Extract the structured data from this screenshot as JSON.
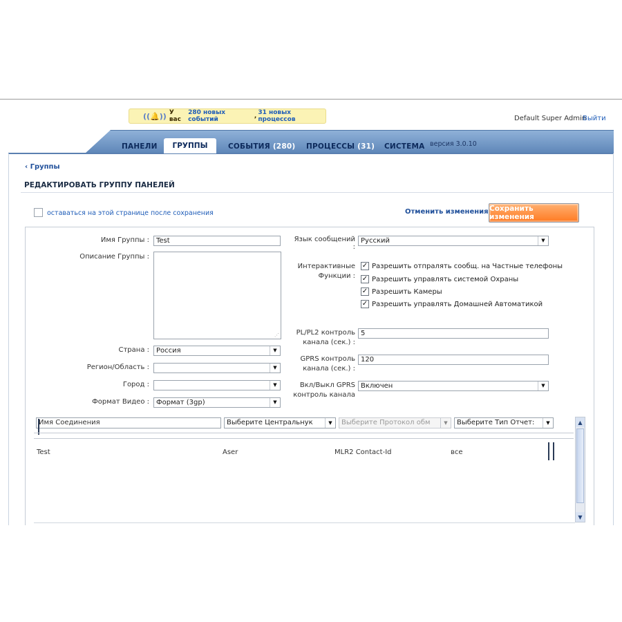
{
  "notification": {
    "prefix": "У вас",
    "events_count": "280 новых событий",
    "separator": ",",
    "processes_count": "31 новых процессов"
  },
  "header": {
    "user": "Default Super Admin",
    "logout": "Выйти",
    "version": "версия 3.0.10"
  },
  "nav": {
    "tabs": [
      {
        "label": "ПАНЕЛИ",
        "count": ""
      },
      {
        "label": "ГРУППЫ",
        "count": ""
      },
      {
        "label": "СОБЫТИЯ",
        "count": "(280)"
      },
      {
        "label": "ПРОЦЕССЫ",
        "count": "(31)"
      },
      {
        "label": "СИСТЕМА",
        "count": ""
      }
    ],
    "active": "ГРУППЫ"
  },
  "breadcrumb": "‹ Группы",
  "page_title": "РЕДАКТИРОВАТЬ ГРУППУ ПАНЕЛЕЙ",
  "stay_label": "оставаться на этой странице после сохранения",
  "actions": {
    "cancel": "Отменить изменения",
    "save": "Сохранить изменения"
  },
  "form": {
    "group_name_label": "Имя Группы :",
    "group_name_value": "Test",
    "description_label": "Описание Группы :",
    "country_label": "Страна :",
    "country_value": "Россия",
    "region_label": "Регион/Область :",
    "region_value": "",
    "city_label": "Город :",
    "city_value": "",
    "video_label": "Формат Видео :",
    "video_value": "Формат (3gp)",
    "lang_label_1": "Язык сообщений",
    "lang_label_2": ":",
    "lang_value": "Русский",
    "interactive_label_1": "Интерактивные",
    "interactive_label_2": "Функции :",
    "checkboxes": [
      {
        "label": "Разрешить отпралять сообщ. на Частные телефоны",
        "checked": true
      },
      {
        "label": "Разрешить управлять системой Охраны",
        "checked": true
      },
      {
        "label": "Разрешить Камеры",
        "checked": true
      },
      {
        "label": "Разрешить управлять Домашней Автоматикой",
        "checked": true
      }
    ],
    "pl_label_1": "PL/PL2 контроль",
    "pl_label_2": "канала (сек.) :",
    "pl_value": "5",
    "gprs_label_1": "GPRS контроль",
    "gprs_label_2": "канала (сек.) :",
    "gprs_value": "120",
    "gprs_onoff_label_1": "Вкл/Выкл GPRS",
    "gprs_onoff_label_2": "контроль канала",
    "gprs_onoff_value": "Включен"
  },
  "grid": {
    "filters": {
      "name_placeholder": "Имя Соединения",
      "central": "Выберите Центральнук",
      "protocol": "Выберите Протокол обм",
      "report": "Выберите Тип Отчет:"
    },
    "rows": [
      {
        "name": "Test",
        "central": "Aser",
        "protocol": "MLR2 Contact-Id",
        "report": "все"
      }
    ]
  },
  "colors": {
    "nav_top": "#8fb1d8",
    "nav_bottom": "#5e86b8",
    "save_button": "#ff7a22",
    "notice_bg": "#fbf3b5",
    "link": "#1f5db8"
  }
}
